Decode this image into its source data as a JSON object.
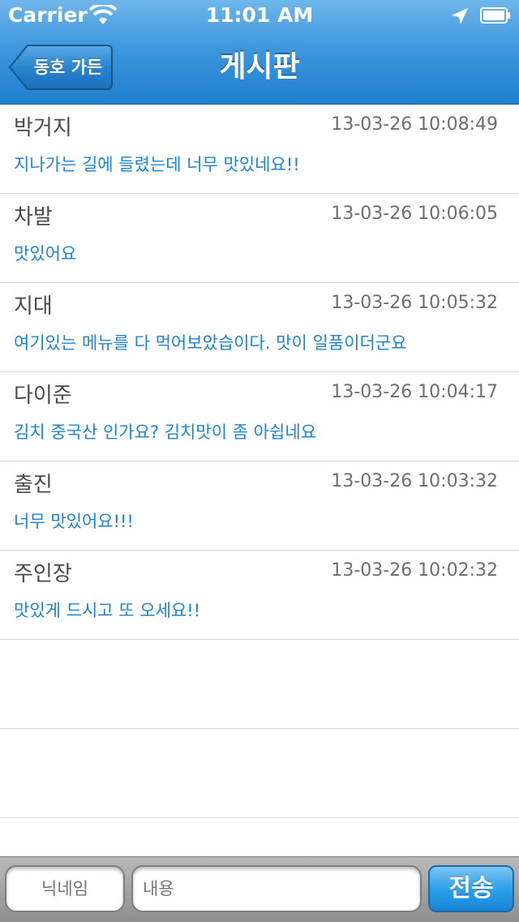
{
  "status_bar": {
    "carrier": "Carrier",
    "time": "11:01 AM",
    "icons": [
      "wifi-icon",
      "location-arrow-icon",
      "battery-icon"
    ]
  },
  "nav": {
    "back_label": "동호 가든",
    "title": "게시판"
  },
  "posts": [
    {
      "author": "박거지",
      "date": "13-03-26 10:08:49",
      "message": "지나가는 길에 들렸는데 너무 맛있네요!!"
    },
    {
      "author": "차발",
      "date": "13-03-26 10:06:05",
      "message": "맛있어요"
    },
    {
      "author": "지대",
      "date": "13-03-26 10:05:32",
      "message": "여기있는 메뉴를 다 먹어보았습이다. 맛이 일품이더군요"
    },
    {
      "author": "다이준",
      "date": "13-03-26 10:04:17",
      "message": "김치 중국산 인가요? 김치맛이 좀 아쉽네요"
    },
    {
      "author": "출진",
      "date": "13-03-26 10:03:32",
      "message": "너무 맛있어요!!!"
    },
    {
      "author": "주인장",
      "date": "13-03-26 10:02:32",
      "message": "맛있게 드시고 또 오세요!!"
    }
  ],
  "input_bar": {
    "nickname_placeholder": "닉네임",
    "content_placeholder": "내용",
    "send_label": "전송"
  },
  "colors": {
    "nav_blue": "#3f97dc",
    "message_blue": "#1c83d4",
    "send_blue": "#2ea0e8"
  }
}
